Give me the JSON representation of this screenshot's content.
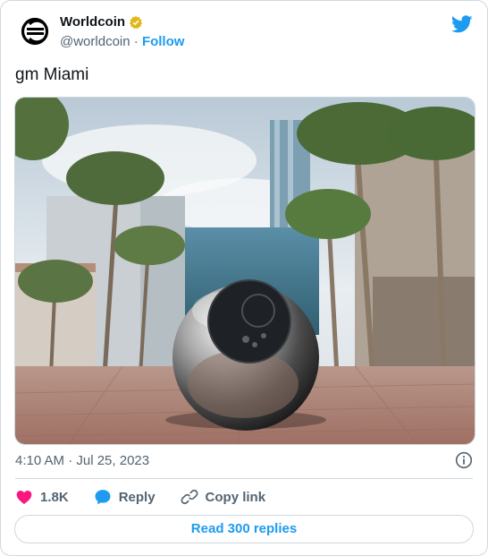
{
  "author": {
    "name": "Worldcoin",
    "handle": "@worldcoin",
    "separator": "·",
    "follow_label": "Follow"
  },
  "tweet": {
    "text": "gm Miami",
    "timestamp": "4:10 AM · Jul 25, 2023"
  },
  "actions": {
    "likes": "1.8K",
    "reply_label": "Reply",
    "copy_label": "Copy link"
  },
  "read_replies": "Read 300 replies",
  "colors": {
    "accent": "#1d9bf0",
    "like": "#f91880",
    "verified": "#e2b719",
    "text_secondary": "#536471"
  },
  "icons": {
    "brand": "twitter-bird-icon",
    "logo": "worldcoin-logo",
    "verified": "verified-badge-icon",
    "info": "info-icon",
    "like": "heart-icon",
    "reply": "speech-bubble-icon",
    "copy": "link-icon"
  }
}
